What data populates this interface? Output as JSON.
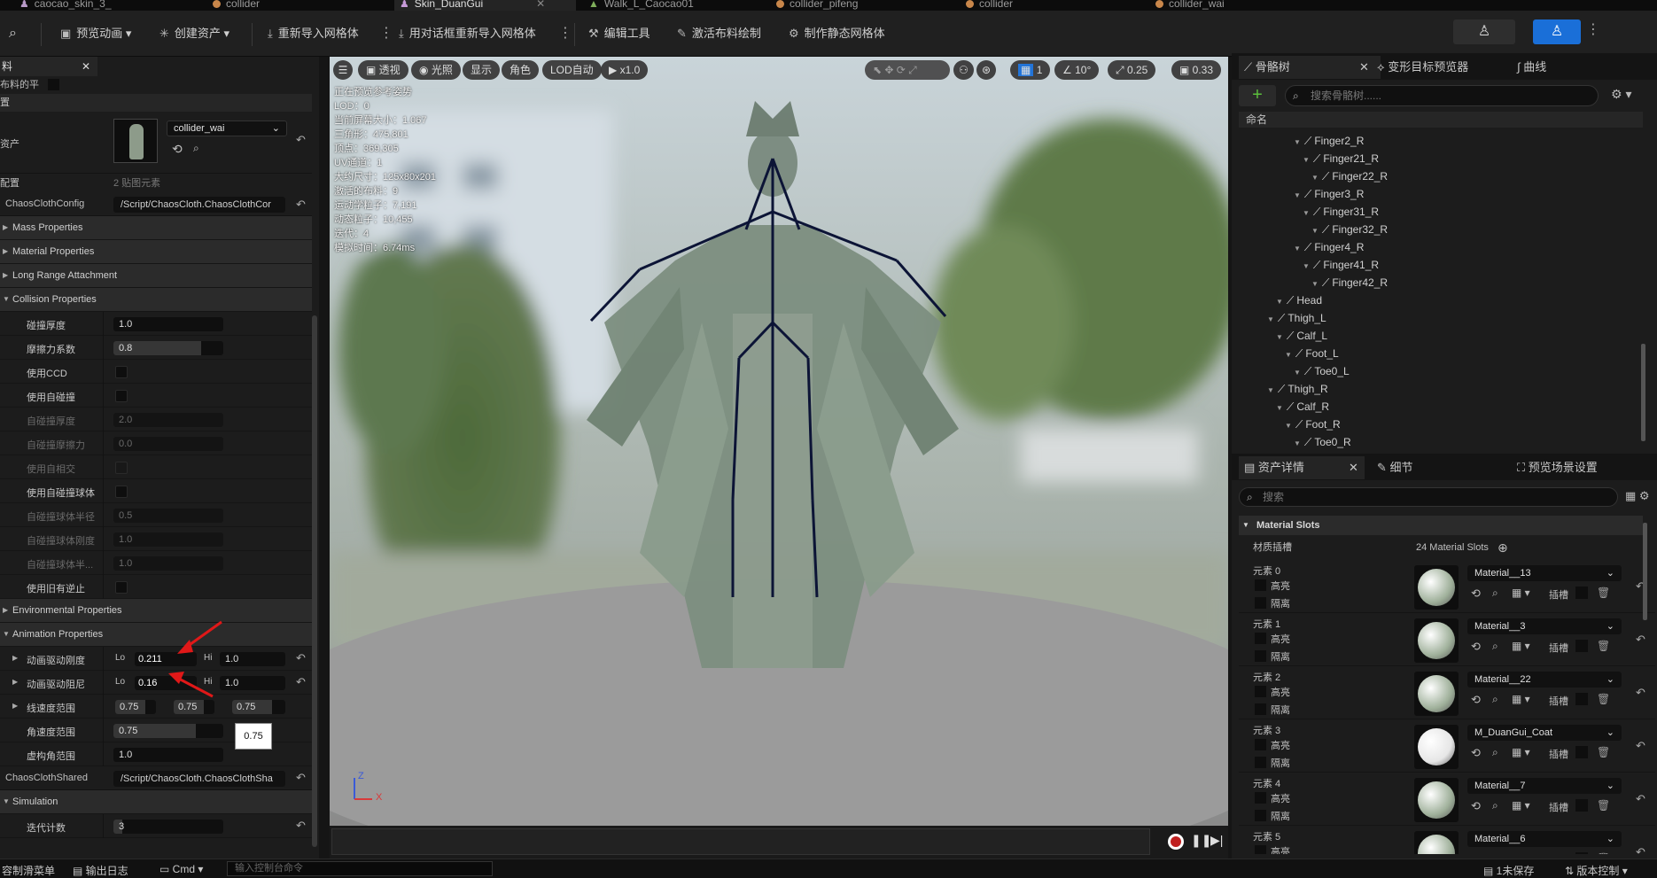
{
  "tabs": [
    {
      "label": "caocao_skin_3_",
      "active": false
    },
    {
      "label": "collider",
      "active": false
    },
    {
      "label": "Skin_DuanGui",
      "active": true
    },
    {
      "label": "Walk_L_Caocao01",
      "active": false
    },
    {
      "label": "collider_pifeng",
      "active": false
    },
    {
      "label": "collider",
      "active": false
    },
    {
      "label": "collider_wai",
      "active": false
    }
  ],
  "toolbar": {
    "preview_anim": "预览动画",
    "create_asset": "创建资产",
    "reimport_mesh": "重新导入网格体",
    "reimport_dialog": "用对话框重新导入网格体",
    "edit_tools": "编辑工具",
    "activate_cloth": "激活布料绘制",
    "make_static": "制作静态网格体"
  },
  "left_panel": {
    "header_partial": "料",
    "row_smooth": "布料的平",
    "row_rows": "置",
    "asset_label": "资产",
    "asset_value": "collider_wai",
    "config_label": "配置",
    "config_value": "2 贴图元素",
    "chaos_config_label": "ChaosClothConfig",
    "chaos_config_path": "/Script/ChaosCloth.ChaosClothCor",
    "categories": {
      "mass": "Mass Properties",
      "material": "Material Properties",
      "long_range": "Long Range Attachment",
      "collision": "Collision Properties",
      "environmental": "Environmental Properties",
      "animation": "Animation Properties",
      "simulation": "Simulation"
    },
    "collision": {
      "thickness_label": "碰撞厚度",
      "thickness_value": "1.0",
      "friction_label": "摩擦力系数",
      "friction_value": "0.8",
      "ccd_label": "使用CCD",
      "self_coll_label": "使用自碰撞",
      "self_thick_label": "自碰撞厚度",
      "self_thick_value": "2.0",
      "self_friction_label": "自碰撞摩擦力",
      "self_friction_value": "0.0",
      "self_intersect_label": "使用自相交",
      "self_sphere_label": "使用自碰撞球体",
      "sphere_radius_label": "自碰撞球体半径",
      "sphere_radius_value": "0.5",
      "sphere_stiff_label": "自碰撞球体刚度",
      "sphere_stiff_value": "1.0",
      "sphere_half_label": "自碰撞球体半...",
      "sphere_half_value": "1.0",
      "legacy_label": "使用旧有逆止"
    },
    "animation": {
      "drive_stiff_label": "动画驱动刚度",
      "lo": "Lo",
      "hi": "Hi",
      "drive_stiff_lo": "0.211",
      "drive_stiff_hi": "1.0",
      "drive_damp_label": "动画驱动阻尼",
      "drive_damp_lo": "0.16",
      "drive_damp_hi": "1.0",
      "linear_vel_label": "线速度范围",
      "linear_vel_x": "0.75",
      "linear_vel_y": "0.75",
      "linear_vel_z": "0.75",
      "tooltip_value": "0.75",
      "angular_vel_label": "角速度范围",
      "angular_vel_value": "0.75",
      "fictitious_label": "虚构角范围",
      "fictitious_value": "1.0"
    },
    "shared_label": "ChaosClothShared",
    "shared_path": "/Script/ChaosCloth.ChaosClothSha",
    "iter_label": "迭代计数",
    "iter_value": "3"
  },
  "viewport": {
    "perspective": "透视",
    "lighting": "光照",
    "show": "显示",
    "character": "角色",
    "lod": "LOD自动",
    "play_speed": "x1.0",
    "grid_count": "1",
    "angle": "10°",
    "scale": "0.25",
    "camera_speed": "0.33",
    "stats": [
      "正在预览参考姿势",
      "LOD：0",
      "当前屏幕大小：1.067",
      "三角形：475,801",
      "顶点：369,305",
      "UV通道：1",
      "大约尺寸：125x80x201",
      "激活的布料：9",
      "运动学粒子：7,191",
      "动态粒子：10,455",
      "迭代：4",
      "模拟时间：6.74ms"
    ],
    "axis_z": "Z",
    "axis_x": "X"
  },
  "skeleton_panel": {
    "tab_skeleton": "骨骼树",
    "tab_morph": "变形目标预览器",
    "tab_curve": "曲线",
    "search_placeholder": "搜索骨骼树......",
    "name_header": "命名",
    "bones": [
      {
        "name": "Finger2_R",
        "depth": 6
      },
      {
        "name": "Finger21_R",
        "depth": 7
      },
      {
        "name": "Finger22_R",
        "depth": 8
      },
      {
        "name": "Finger3_R",
        "depth": 6
      },
      {
        "name": "Finger31_R",
        "depth": 7
      },
      {
        "name": "Finger32_R",
        "depth": 8
      },
      {
        "name": "Finger4_R",
        "depth": 6
      },
      {
        "name": "Finger41_R",
        "depth": 7
      },
      {
        "name": "Finger42_R",
        "depth": 8
      },
      {
        "name": "Head",
        "depth": 4
      },
      {
        "name": "Thigh_L",
        "depth": 3
      },
      {
        "name": "Calf_L",
        "depth": 4
      },
      {
        "name": "Foot_L",
        "depth": 5
      },
      {
        "name": "Toe0_L",
        "depth": 6
      },
      {
        "name": "Thigh_R",
        "depth": 3
      },
      {
        "name": "Calf_R",
        "depth": 4
      },
      {
        "name": "Foot_R",
        "depth": 5
      },
      {
        "name": "Toe0_R",
        "depth": 6
      }
    ]
  },
  "details_panel": {
    "tab_asset": "资产详情",
    "tab_details": "细节",
    "tab_scene": "预览场景设置",
    "search_placeholder": "搜索",
    "section": "Material Slots",
    "slots_label": "材质插槽",
    "slots_count": "24 Material Slots",
    "highlight": "高亮",
    "isolate": "隔离",
    "slot_label": "插槽",
    "slots": [
      {
        "element": "元素 0",
        "material": "Material__13",
        "sphere": "#9fb09a"
      },
      {
        "element": "元素 1",
        "material": "Material__3",
        "sphere": "#9fb09a"
      },
      {
        "element": "元素 2",
        "material": "Material__22",
        "sphere": "#9fb09a"
      },
      {
        "element": "元素 3",
        "material": "M_DuanGui_Coat",
        "sphere": "#e6e6e6"
      },
      {
        "element": "元素 4",
        "material": "Material__7",
        "sphere": "#9fb09a"
      },
      {
        "element": "元素 5",
        "material": "Material__6",
        "sphere": "#9fb09a"
      }
    ]
  },
  "statusbar": {
    "content_drawer": "容制滑菜单",
    "output_log": "输出日志",
    "cmd": "Cmd",
    "console_placeholder": "输入控制台命令",
    "unsaved": "1未保存",
    "source_control": "版本控制"
  },
  "colors": {
    "accent": "#1a6fd8",
    "record": "#c02020"
  }
}
